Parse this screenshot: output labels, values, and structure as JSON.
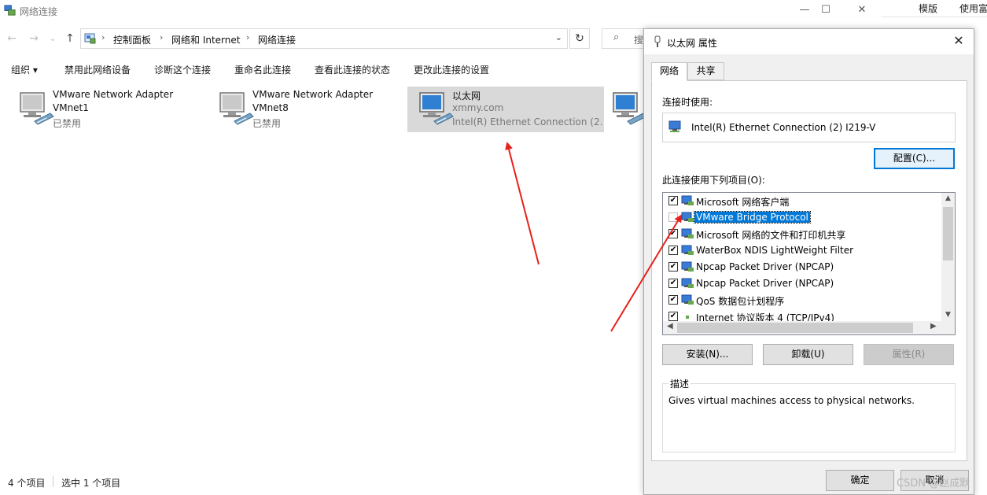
{
  "explorer": {
    "title": "网络连接",
    "window_controls": {
      "minimize": "—",
      "maximize": "☐",
      "close": "✕"
    },
    "nav": {
      "back": "←",
      "forward": "→",
      "recent": "⌄",
      "up": "↑"
    },
    "breadcrumb": [
      "控制面板",
      "网络和 Internet",
      "网络连接"
    ],
    "breadcrumb_sep": "›",
    "address_dropdown": "⌄",
    "refresh": "↻",
    "search_placeholder": "搜",
    "commands": {
      "organize": "组织 ▾",
      "disable": "禁用此网络设备",
      "diagnose": "诊断这个连接",
      "rename": "重命名此连接",
      "view_status": "查看此连接的状态",
      "change_settings": "更改此连接的设置"
    },
    "items": [
      {
        "name": "VMware Network Adapter",
        "line2": "VMnet1",
        "line3": "已禁用"
      },
      {
        "name": "VMware Network Adapter",
        "line2": "VMnet8",
        "line3": "已禁用"
      },
      {
        "name": "以太网",
        "line2": "xmmy.com",
        "line3": "Intel(R) Ethernet Connection (2..."
      }
    ],
    "status": {
      "count": "4 个项目",
      "selected": "选中 1 个项目"
    }
  },
  "background_app": {
    "item1": "模版",
    "item2": "使用富"
  },
  "dialog": {
    "title": "以太网 属性",
    "close": "✕",
    "tabs": [
      "网络",
      "共享"
    ],
    "connect_using_label": "连接时使用:",
    "adapter": "Intel(R) Ethernet Connection (2) I219-V",
    "configure_button": "配置(C)...",
    "items_label": "此连接使用下列项目(O):",
    "items": [
      {
        "label": "Microsoft 网络客户端",
        "checked": true,
        "selected": false
      },
      {
        "label": "VMware Bridge Protocol",
        "checked": false,
        "selected": true
      },
      {
        "label": "Microsoft 网络的文件和打印机共享",
        "checked": true,
        "selected": false
      },
      {
        "label": "WaterBox NDIS LightWeight Filter",
        "checked": true,
        "selected": false
      },
      {
        "label": "Npcap Packet Driver (NPCAP)",
        "checked": true,
        "selected": false
      },
      {
        "label": "Npcap Packet Driver (NPCAP)",
        "checked": true,
        "selected": false
      },
      {
        "label": "QoS 数据包计划程序",
        "checked": true,
        "selected": false
      },
      {
        "label": "Internet 协议版本 4 (TCP/IPv4)",
        "checked": true,
        "selected": false
      }
    ],
    "install_button": "安装(N)...",
    "uninstall_button": "卸载(U)",
    "properties_button": "属性(R)",
    "description_title": "描述",
    "description_text": "Gives virtual machines access to physical networks.",
    "ok_button": "确定",
    "cancel_button": "取消"
  },
  "watermark": "CSDN @赵成默",
  "colors": {
    "selection": "#0078d7",
    "annotation_arrow": "#e8201a",
    "selected_item_bg": "#d9d9d9"
  }
}
